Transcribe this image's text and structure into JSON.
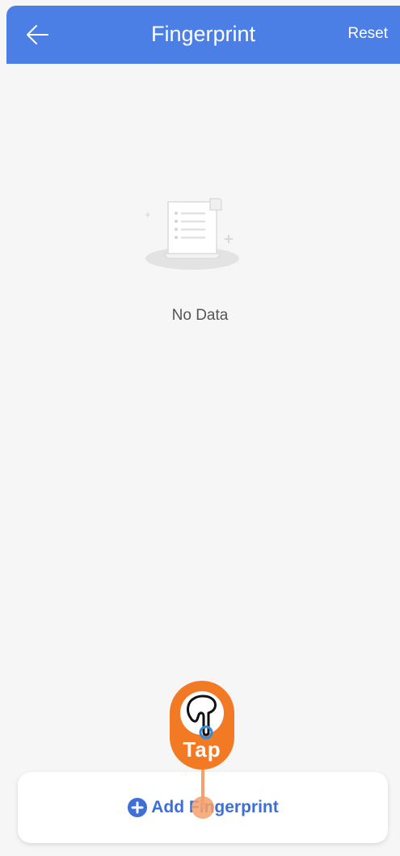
{
  "header": {
    "title": "Fingerprint",
    "reset_label": "Reset",
    "back_icon": "arrow-left-icon",
    "background_color": "#4b7fe6"
  },
  "empty_state": {
    "illustration_icon": "document-list-icon",
    "message": "No Data"
  },
  "add_button": {
    "icon": "plus-circle-icon",
    "label": "Add Fingerprint",
    "color": "#3d6fd6"
  },
  "tap_hint": {
    "label": "Tap",
    "icon": "hand-pointer-icon",
    "color": "#f37a24"
  }
}
